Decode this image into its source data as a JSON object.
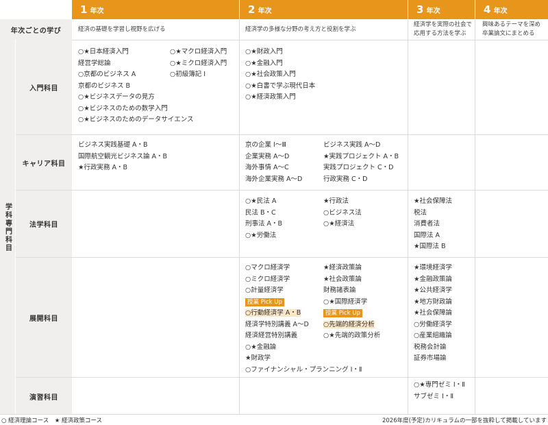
{
  "years": [
    {
      "num": "1",
      "suffix": "年次"
    },
    {
      "num": "2",
      "suffix": "年次"
    },
    {
      "num": "3",
      "suffix": "年次"
    },
    {
      "num": "4",
      "suffix": "年次"
    }
  ],
  "learning_row": {
    "label": "年次ごとの学び",
    "y1": "経済の基礎を学習し視野を広げる",
    "y2": "経済学の多様な分野の考え方と役割を学ぶ",
    "y3": [
      "経済学を実際の社会で",
      "応用する方法を学ぶ"
    ],
    "y4": [
      "興味あるテーマを深め",
      "卒業論文にまとめる"
    ]
  },
  "side_label": "学科専門科目",
  "rows": {
    "intro": {
      "label": "入門科目",
      "y1_col_a": [
        "○★日本経済入門",
        "経営学総論",
        "○京都のビジネス A",
        "京都のビジネス B",
        "○★ビジネスデータの見方",
        "○★ビジネスのための数学入門",
        "○★ビジネスのためのデータサイエンス"
      ],
      "y1_col_b": [
        "○★マクロ経済入門",
        "○★ミクロ経済入門",
        "○初級簿記 Ⅰ"
      ],
      "y2_col_a": [
        "○★財政入門",
        "○★金融入門",
        "○★社会政策入門",
        "○★白書で学ぶ現代日本",
        "○★経済政策入門"
      ]
    },
    "career": {
      "label": "キャリア科目",
      "y1_col_a": [
        "ビジネス実践基礎 A・B",
        "国際航空観光ビジネス論 A・B",
        "★行政実務 A・B"
      ],
      "y2_col_a": [
        "京の企業 Ⅰ〜Ⅲ",
        "企業実務 A〜D",
        "海外事情 A〜C",
        "海外企業実務 A〜D"
      ],
      "y2_col_b": [
        "ビジネス実践 A〜D",
        "★実践プロジェクト A・B",
        "実践プロジェクト C・D",
        "行政実務 C・D"
      ]
    },
    "law": {
      "label": "法学科目",
      "y2_col_a": [
        "○★民法 A",
        "民法 B・C",
        "刑事法 A・B",
        "○★労働法"
      ],
      "y2_col_b": [
        "★行政法",
        "○ビジネス法",
        "○★経済法"
      ],
      "y3_col_a": [
        "★社会保障法",
        "税法",
        "消費者法",
        "国際法 A",
        "★国際法 B"
      ]
    },
    "advanced": {
      "label": "展開科目",
      "y2_col_a_top": [
        "○マクロ経済学",
        "○ミクロ経済学",
        "○計量経済学"
      ],
      "pickup_label": "授業 Pick Up",
      "y2_col_a_pick": "○行動経済学 A・B",
      "y2_col_a_bottom": [
        "経済学特別講義 A〜D",
        "経済経営特別講義",
        "○★金融論",
        "★財政学",
        "○ファイナンシャル・プランニング Ⅰ・Ⅱ"
      ],
      "y2_col_b_top": [
        "★経済政策論",
        "★社会政策論",
        "財務諸表論",
        "○★国際経済学"
      ],
      "y2_col_b_pick": "○先端的経済分析",
      "y2_col_b_bottom": [
        "○★先端的政策分析"
      ],
      "y3_col_a": [
        "★環境経済学",
        "★金融政策論",
        "★公共経済学",
        "★地方財政論",
        "★社会保障論",
        "○労働経済学",
        "○産業組織論",
        "税務会計論",
        "証券市場論"
      ]
    },
    "seminar": {
      "label": "演習科目",
      "y3_col_a": [
        "○★専門ゼミ Ⅰ・Ⅱ",
        "サブゼミ Ⅰ・Ⅱ"
      ]
    }
  },
  "footer": {
    "legend": "○ 経済理論コース　★ 経済政策コース",
    "note": "2026年度(予定)カリキュラムの一部を抜粋して掲載しています"
  },
  "colors": {
    "accent": "#e8951c",
    "label_bg": "#f0efed",
    "highlight": "#fbe7c6"
  }
}
